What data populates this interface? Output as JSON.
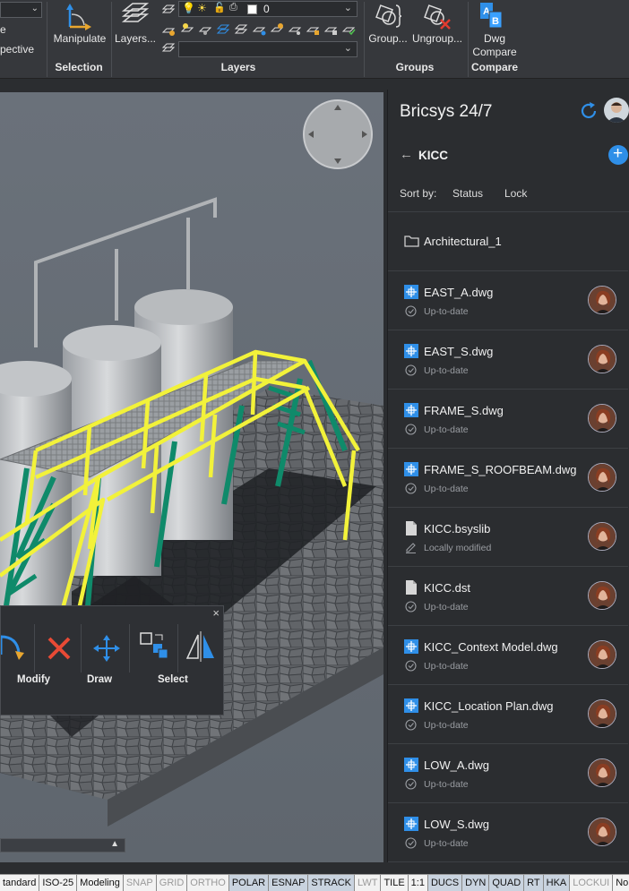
{
  "ribbon": {
    "left_label_1": "e",
    "left_label_2": "pective",
    "manipulate_label": "Manipulate",
    "selection_group": "Selection",
    "layers_button": "Layers...",
    "layer_combo_value": "0",
    "layers_group": "Layers",
    "group_button": "Group...",
    "ungroup_button": "Ungroup...",
    "groups_group": "Groups",
    "dwg_compare_line1": "Dwg",
    "dwg_compare_line2": "Compare",
    "compare_group": "Compare"
  },
  "panel": {
    "title": "Bricsys 24/7",
    "folder_title": "KICC",
    "sort_label": "Sort by:",
    "sort_status": "Status",
    "sort_lock": "Lock",
    "folder_item": "Architectural_1",
    "files": [
      {
        "name": "EAST_A.dwg",
        "status": "Up-to-date",
        "type": "dwg",
        "state": "ok"
      },
      {
        "name": "EAST_S.dwg",
        "status": "Up-to-date",
        "type": "dwg",
        "state": "ok"
      },
      {
        "name": "FRAME_S.dwg",
        "status": "Up-to-date",
        "type": "dwg",
        "state": "ok"
      },
      {
        "name": "FRAME_S_ROOFBEAM.dwg",
        "status": "Up-to-date",
        "type": "dwg",
        "state": "ok"
      },
      {
        "name": "KICC.bsyslib",
        "status": "Locally modified",
        "type": "doc",
        "state": "edit"
      },
      {
        "name": "KICC.dst",
        "status": "Up-to-date",
        "type": "doc",
        "state": "ok"
      },
      {
        "name": "KICC_Context Model.dwg",
        "status": "Up-to-date",
        "type": "dwg",
        "state": "ok"
      },
      {
        "name": "KICC_Location Plan.dwg",
        "status": "Up-to-date",
        "type": "dwg",
        "state": "ok"
      },
      {
        "name": "LOW_A.dwg",
        "status": "Up-to-date",
        "type": "dwg",
        "state": "ok"
      },
      {
        "name": "LOW_S.dwg",
        "status": "Up-to-date",
        "type": "dwg",
        "state": "ok"
      }
    ]
  },
  "quad": {
    "modify_label": "Modify",
    "draw_label": "Draw",
    "select_label": "Select",
    "close_glyph": "×"
  },
  "statusbar": {
    "items": [
      {
        "label": "tandard",
        "state": "normal"
      },
      {
        "label": "ISO-25",
        "state": "normal"
      },
      {
        "label": "Modeling",
        "state": "normal"
      },
      {
        "label": "SNAP",
        "state": "off"
      },
      {
        "label": "GRID",
        "state": "off"
      },
      {
        "label": "ORTHO",
        "state": "off"
      },
      {
        "label": "POLAR",
        "state": "on"
      },
      {
        "label": "ESNAP",
        "state": "on"
      },
      {
        "label": "STRACK",
        "state": "on"
      },
      {
        "label": "LWT",
        "state": "off"
      },
      {
        "label": "TILE",
        "state": "normal"
      },
      {
        "label": "1:1",
        "state": "normal"
      },
      {
        "label": "DUCS",
        "state": "on"
      },
      {
        "label": "DYN",
        "state": "on"
      },
      {
        "label": "QUAD",
        "state": "on"
      },
      {
        "label": "RT",
        "state": "on"
      },
      {
        "label": "HKA",
        "state": "on"
      },
      {
        "label": "LOCKUI",
        "state": "off"
      },
      {
        "label": "None",
        "state": "normal"
      }
    ]
  },
  "colors": {
    "accent_blue": "#2f8fe8",
    "railing_yellow": "#f2f23a",
    "structure_green": "#0f8a6a"
  }
}
